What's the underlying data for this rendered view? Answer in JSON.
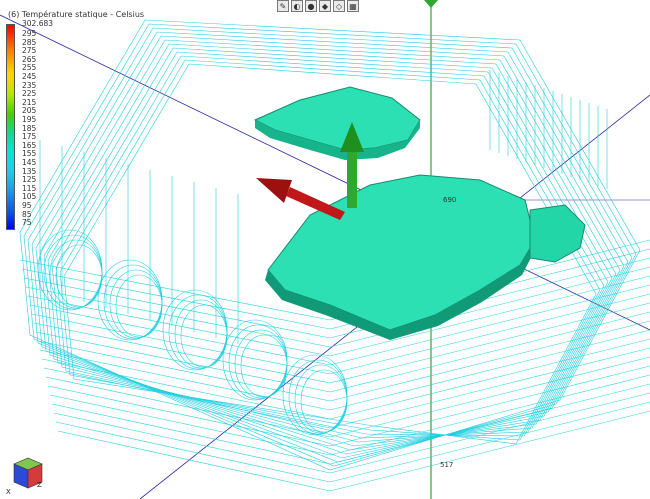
{
  "legend": {
    "title": "(6) Température statique - Celsius",
    "max_label": "302.683",
    "ticks": [
      "295",
      "285",
      "275",
      "265",
      "255",
      "245",
      "235",
      "225",
      "215",
      "205",
      "195",
      "185",
      "175",
      "165",
      "155",
      "145",
      "135",
      "125",
      "115",
      "105",
      "95",
      "85",
      "75"
    ]
  },
  "toolbar": {
    "buttons": [
      {
        "name": "edit-icon",
        "glyph": "✎"
      },
      {
        "name": "shading-icon",
        "glyph": "◐"
      },
      {
        "name": "sphere-icon",
        "glyph": "●"
      },
      {
        "name": "light-icon",
        "glyph": "◆"
      },
      {
        "name": "render-mode-icon",
        "glyph": "◇"
      },
      {
        "name": "grid-icon",
        "glyph": "▦"
      }
    ]
  },
  "readouts": {
    "top": "690",
    "bottom": "517"
  },
  "triad": {
    "label_z": "Z",
    "label_x": "X"
  },
  "colors": {
    "wire": "#1fcfe0",
    "solid": "#2de0b3",
    "axis_blue": "#2a2aa0",
    "axis_green": "#2ea82e",
    "arrow_red": "#c01818"
  }
}
